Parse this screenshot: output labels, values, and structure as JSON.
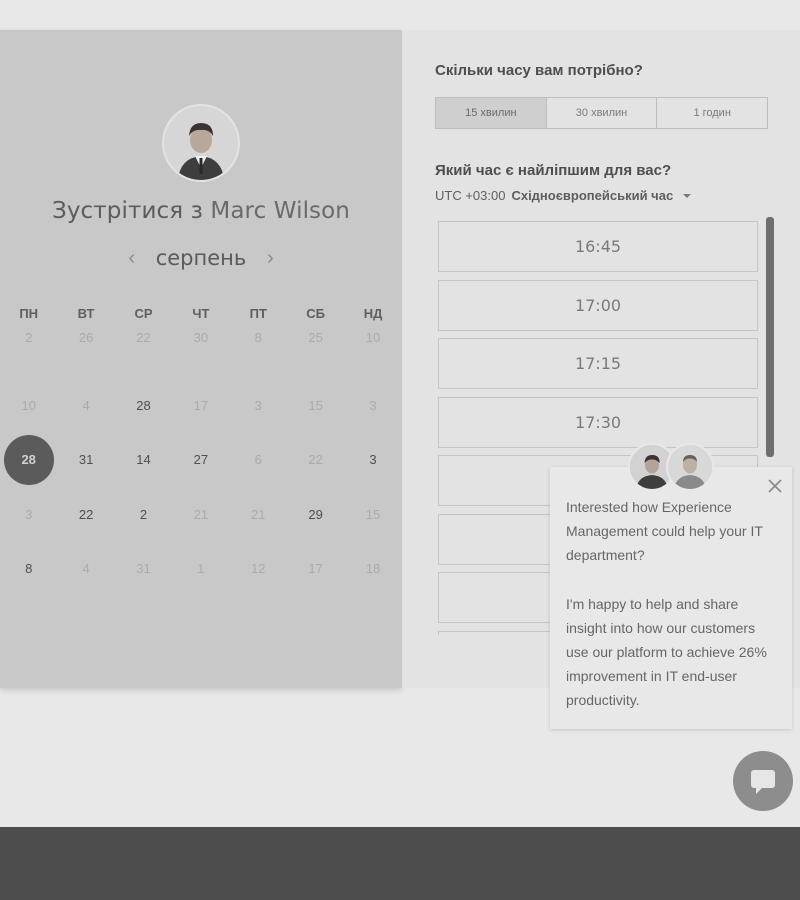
{
  "colors": {
    "accent": "#5b5b5b",
    "panel_left": "#c8c8c8",
    "panel_right": "#e3e3e3",
    "footer": "#4d4d4d"
  },
  "host": {
    "prefix": "Зустрітися з",
    "name": "Marc Wilson",
    "avatar_icon": "person-avatar"
  },
  "calendar": {
    "month": "серпень",
    "prev_icon": "chevron-left-icon",
    "next_icon": "chevron-right-icon",
    "weekdays": [
      "ПН",
      "ВТ",
      "СР",
      "ЧТ",
      "ПТ",
      "СБ",
      "НД"
    ],
    "rows": [
      [
        {
          "d": "2",
          "s": "dim"
        },
        {
          "d": "26",
          "s": "dim"
        },
        {
          "d": "22",
          "s": "dim"
        },
        {
          "d": "30",
          "s": "dim"
        },
        {
          "d": "8",
          "s": "dim"
        },
        {
          "d": "25",
          "s": "dim"
        },
        {
          "d": "10",
          "s": "dim"
        }
      ],
      [
        {
          "d": "10",
          "s": "dim"
        },
        {
          "d": "4",
          "s": "dim"
        },
        {
          "d": "28",
          "s": "avail"
        },
        {
          "d": "17",
          "s": "dim"
        },
        {
          "d": "3",
          "s": "dim"
        },
        {
          "d": "15",
          "s": "dim"
        },
        {
          "d": "3",
          "s": "dim"
        }
      ],
      [
        {
          "d": "28",
          "s": "selected"
        },
        {
          "d": "31",
          "s": "avail"
        },
        {
          "d": "14",
          "s": "avail"
        },
        {
          "d": "27",
          "s": "avail"
        },
        {
          "d": "6",
          "s": "dim"
        },
        {
          "d": "22",
          "s": "dim"
        },
        {
          "d": "3",
          "s": "avail"
        }
      ],
      [
        {
          "d": "3",
          "s": "dim"
        },
        {
          "d": "22",
          "s": "avail"
        },
        {
          "d": "2",
          "s": "avail"
        },
        {
          "d": "21",
          "s": "dim"
        },
        {
          "d": "21",
          "s": "dim"
        },
        {
          "d": "29",
          "s": "avail"
        },
        {
          "d": "15",
          "s": "dim"
        }
      ],
      [
        {
          "d": "8",
          "s": "avail"
        },
        {
          "d": "4",
          "s": "dim"
        },
        {
          "d": "31",
          "s": "dim"
        },
        {
          "d": "1",
          "s": "dim"
        },
        {
          "d": "12",
          "s": "dim"
        },
        {
          "d": "17",
          "s": "dim"
        },
        {
          "d": "18",
          "s": "dim"
        }
      ]
    ]
  },
  "duration": {
    "question": "Скільки часу вам потрібно?",
    "options": [
      "15 хвилин",
      "30 хвилин",
      "1 годин"
    ],
    "selected": "15 хвилин"
  },
  "time": {
    "question": "Який час є найліпшим для вас?",
    "tz_offset": "UTC +03:00",
    "tz_name": "Східноєвропейський час",
    "slots": [
      "16:45",
      "17:00",
      "17:15",
      "17:30",
      "",
      "",
      "",
      ""
    ]
  },
  "chat": {
    "paragraph1": "Interested how Experience Management could help your IT department?",
    "paragraph2": "I'm happy to help and share insight into how our customers use our platform to achieve 26% improvement in IT end-user productivity.",
    "close_icon": "close-icon",
    "launcher_icon": "chat-bubble-icon"
  }
}
